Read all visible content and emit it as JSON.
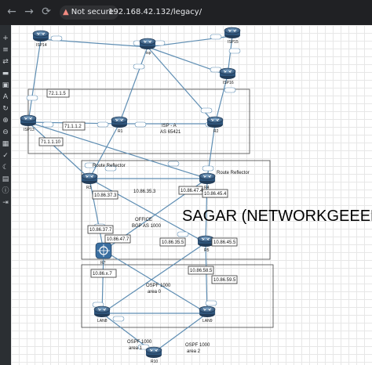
{
  "browser": {
    "security_label": "Not secure",
    "url": "192.168.42.132/legacy/"
  },
  "watermark": "SAGAR (NETWORKGEEEK)",
  "routers": {
    "isp14": "ISP14",
    "isp": "isp",
    "isp15": "ISP15",
    "isp16": "ISP16",
    "isp13": "ISP13",
    "r1": "R1",
    "r2": "R2",
    "r3": "R3",
    "r4": "R4",
    "r5": "R5",
    "r7": "R7",
    "lan8": "LAN8",
    "lan9": "LAN9",
    "r10": "R10"
  },
  "labels": {
    "ip_72": "72.1.1.5",
    "ip_71a": "71.1.1.2",
    "ip_71b": "71.1.1.10",
    "isp_a": "ISP - A",
    "as_65421": "AS 65421",
    "rr_left": "Route Reflector",
    "rr_right": "Route Reflector",
    "ip_37_3": "10.86.37.3",
    "ip_35_3": "10.86.35.3",
    "ip_47_4": "10.86.47.4",
    "ip_45_4": "10.86.45.4",
    "office": "OFFICE",
    "bgp_as": "BGP AS 1000",
    "ip_37_7": "10.86.37.7",
    "ip_47_7": "10.86.47.7",
    "ip_35_5": "10.86.35.5",
    "ip_45_5": "10.86.45.5",
    "ip_58_5": "10.86.58.5",
    "ip_59_5": "10.86.59.5",
    "ip_x_7": "10.86.x.7",
    "ospf_area0": "OSPF 1000",
    "area0": "area 0",
    "ospf_area1": "OSPF 1000",
    "area1": "area 1",
    "ospf_area2": "OSPF 1000",
    "area2": "area 2"
  },
  "toolbar_icons": [
    "add-icon",
    "list-icon",
    "layers-icon",
    "server-icon",
    "picture-icon",
    "text-icon",
    "refresh-icon",
    "zoom-in-icon",
    "zoom-out-icon",
    "grid-icon",
    "check-icon",
    "moon-icon",
    "lock-icon",
    "info-icon",
    "exit-icon"
  ]
}
